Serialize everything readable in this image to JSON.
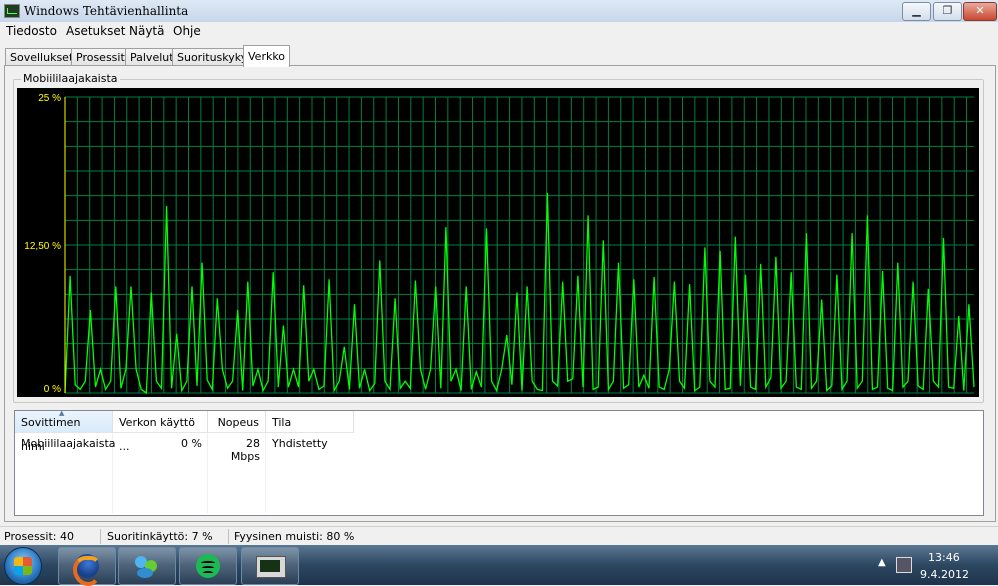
{
  "window": {
    "title": "Windows Tehtävienhallinta",
    "buttons": {
      "minimize": "▁",
      "maximize": "❐",
      "close": "✕"
    }
  },
  "menu": [
    "Tiedosto",
    "Asetukset",
    "Näytä",
    "Ohje"
  ],
  "tabs": [
    "Sovellukset",
    "Prosessit",
    "Palvelut",
    "Suorituskyky",
    "Verkko"
  ],
  "active_tab": "Verkko",
  "graph": {
    "label": "Mobiililaajakaista",
    "y_labels": [
      "25 %",
      "12,50 %",
      "0 %"
    ],
    "colors": {
      "background": "#000000",
      "grid": "#008040",
      "line": "#00ff00",
      "axis": "#ffff00"
    },
    "chart_data": {
      "type": "line",
      "title": "Mobiililaajakaista",
      "ylim": [
        0,
        25
      ],
      "unit": "%",
      "grid": true,
      "series": [
        {
          "values": [
            0,
            9.9,
            0.7,
            0.3,
            1,
            7,
            0.5,
            2,
            0.3,
            1,
            9,
            0.4,
            2,
            9,
            2,
            0.3,
            0,
            8.5,
            1,
            0.4,
            15.8,
            0.4,
            5,
            0.2,
            1,
            9,
            0.6,
            11,
            1.1,
            0.3,
            8,
            2,
            0.4,
            1,
            7,
            0.2,
            9.4,
            0.6,
            2,
            0.2,
            1,
            10.2,
            0.5,
            5.7,
            0.5,
            2,
            0.5,
            9.1,
            1,
            2,
            0.3,
            0.6,
            9.6,
            0.2,
            1,
            3.9,
            0.3,
            7.5,
            0.4,
            2,
            0.2,
            0.8,
            11.2,
            1,
            0.3,
            8,
            0.4,
            1,
            0.4,
            9.5,
            2,
            0.3,
            2,
            9,
            0.4,
            14,
            1,
            2,
            0.2,
            9,
            0.3,
            1.8,
            0.5,
            13.9,
            1,
            0.2,
            2,
            4.9,
            0.7,
            8.5,
            0.2,
            9,
            1,
            0.3,
            0.2,
            16.9,
            1,
            0.6,
            9.4,
            1,
            1.2,
            9.9,
            0.5,
            15,
            0.3,
            0.5,
            12.9,
            0.3,
            1,
            11,
            0.4,
            0.7,
            9.6,
            0.5,
            1.5,
            0.4,
            9.8,
            0.5,
            0.3,
            2,
            9.4,
            1,
            0.4,
            9.2,
            0.2,
            0.5,
            12.3,
            1,
            0.5,
            12,
            0.3,
            0.4,
            13.2,
            0.6,
            10,
            0.5,
            0.3,
            10.9,
            0.5,
            1.3,
            11.5,
            0.4,
            1,
            10.2,
            0.5,
            0.3,
            13.5,
            0.4,
            1,
            7.9,
            0.2,
            0.6,
            10,
            0.3,
            1,
            13.5,
            0.4,
            1,
            15,
            0.3,
            0.5,
            10.3,
            0.4,
            0.2,
            11,
            0.5,
            1,
            9.4,
            0.6,
            0.3,
            8.8,
            1,
            0.5,
            13.1,
            0.5,
            0.4,
            6.5,
            0.2,
            7.5,
            0.5
          ]
        }
      ]
    }
  },
  "table": {
    "columns": [
      "Sovittimen nimi",
      "Verkon käyttö ...",
      "Nopeus",
      "Tila"
    ],
    "rows": [
      {
        "name": "Mobiililaajakaista",
        "usage": "0 %",
        "speed": "28 Mbps",
        "state": "Yhdistetty"
      }
    ]
  },
  "status": {
    "processes": "Prosessit: 40",
    "cpu": "Suoritinkäyttö: 7 %",
    "memory": "Fyysinen muisti: 80 %"
  },
  "taskbar": {
    "apps": [
      {
        "icon": "firefox-icon"
      },
      {
        "icon": "messenger-icon"
      },
      {
        "icon": "spotify-icon"
      },
      {
        "icon": "task-manager-icon"
      }
    ],
    "time": "13:46",
    "date": "9.4.2012"
  }
}
